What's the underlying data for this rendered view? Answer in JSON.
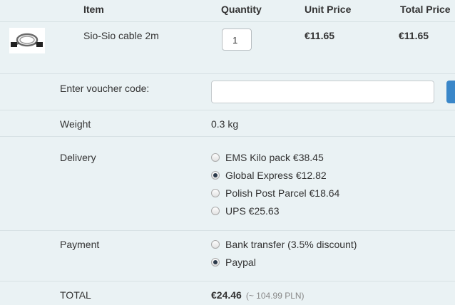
{
  "columns": {
    "item": "Item",
    "quantity": "Quantity",
    "unit_price": "Unit Price",
    "total_price": "Total Price"
  },
  "cart_item": {
    "name": "Sio-Sio cable 2m",
    "quantity": "1",
    "unit_price": "€11.65",
    "total_price": "€11.65"
  },
  "voucher": {
    "label": "Enter voucher code:",
    "value": ""
  },
  "weight": {
    "label": "Weight",
    "value": "0.3 kg"
  },
  "delivery": {
    "label": "Delivery",
    "options": [
      {
        "label": "EMS Kilo pack €38.45",
        "selected": false
      },
      {
        "label": "Global Express €12.82",
        "selected": true
      },
      {
        "label": "Polish Post Parcel €18.64",
        "selected": false
      },
      {
        "label": "UPS €25.63",
        "selected": false
      }
    ]
  },
  "payment": {
    "label": "Payment",
    "options": [
      {
        "label": "Bank transfer (3.5% discount)",
        "selected": false
      },
      {
        "label": "Paypal",
        "selected": true
      }
    ]
  },
  "total": {
    "label": "TOTAL",
    "value": "€24.46",
    "pln": "(~ 104.99 PLN)"
  },
  "colors": {
    "background": "#eaf2f4",
    "accent": "#3a87c9"
  }
}
